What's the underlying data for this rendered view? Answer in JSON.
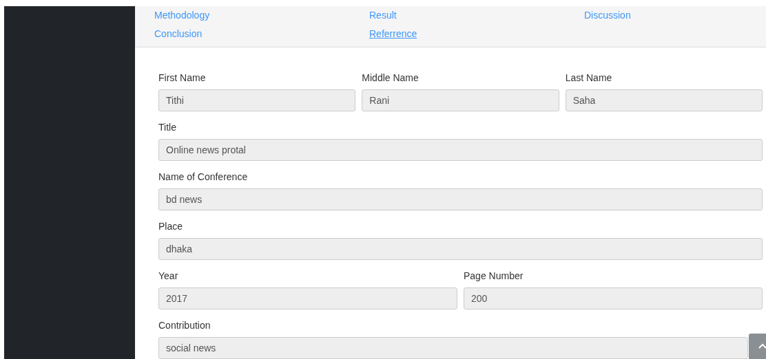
{
  "nav_links": [
    {
      "label": "Methodology",
      "hovered": false
    },
    {
      "label": "Result",
      "hovered": false
    },
    {
      "label": "Discussion",
      "hovered": false
    },
    {
      "label": "Conclusion",
      "hovered": false
    },
    {
      "label": "Referrence",
      "hovered": true
    }
  ],
  "form_rows": [
    {
      "fields": [
        {
          "label": "First Name",
          "value": "Tithi"
        },
        {
          "label": "Middle Name",
          "value": "Rani"
        },
        {
          "label": "Last Name",
          "value": "Saha"
        }
      ]
    },
    {
      "fields": [
        {
          "label": "Title",
          "value": "Online news protal"
        }
      ]
    },
    {
      "fields": [
        {
          "label": "Name of Conference",
          "value": "bd news"
        }
      ]
    },
    {
      "fields": [
        {
          "label": "Place",
          "value": "dhaka"
        }
      ]
    },
    {
      "fields": [
        {
          "label": "Year",
          "value": "2017"
        },
        {
          "label": "Page Number",
          "value": "200"
        }
      ]
    },
    {
      "fields": [
        {
          "label": "Contribution",
          "value": "social news"
        }
      ]
    }
  ]
}
